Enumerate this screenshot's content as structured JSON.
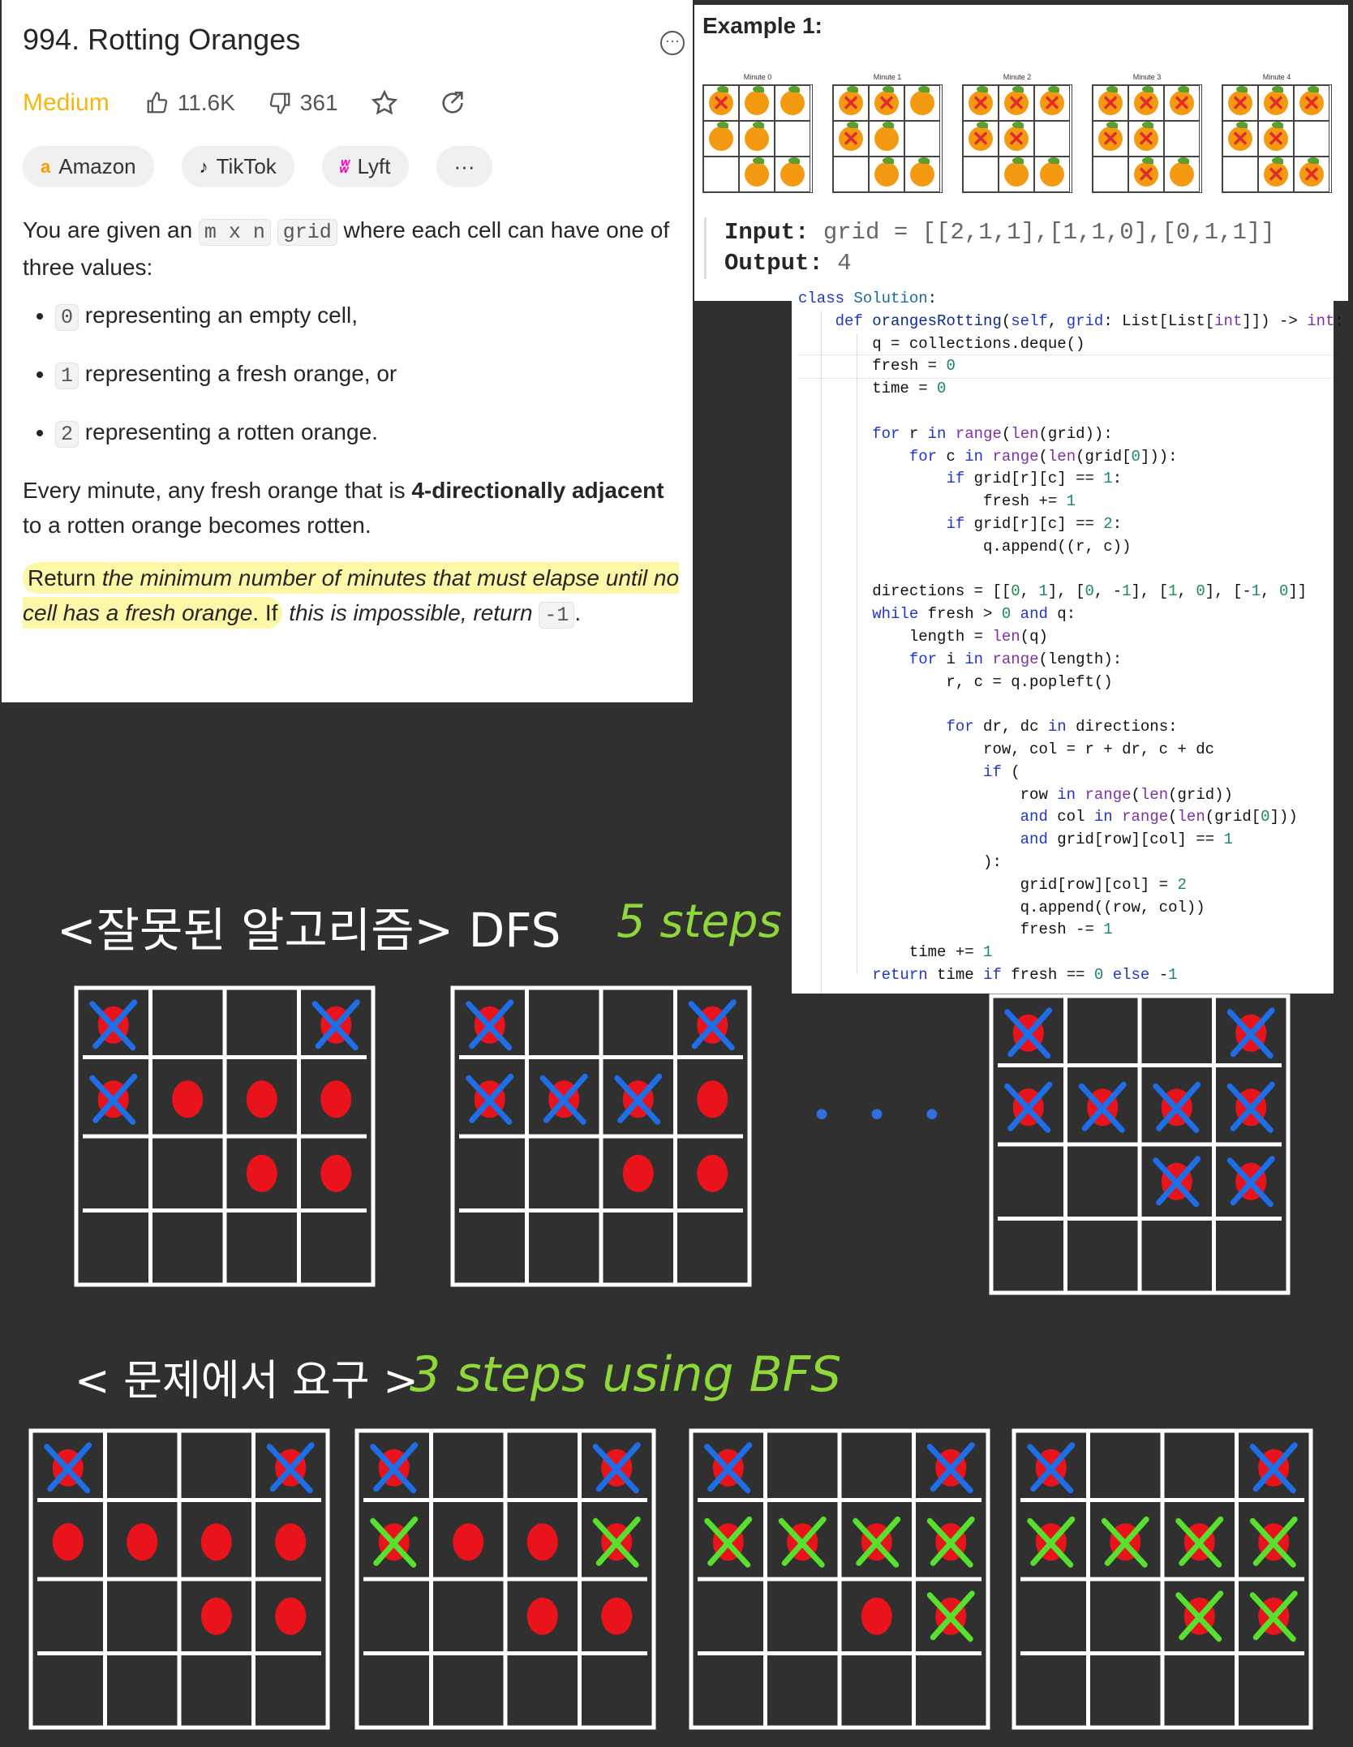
{
  "problem": {
    "title": "994. Rotting Oranges",
    "difficulty": "Medium",
    "likes": "11.6K",
    "dislikes": "361",
    "tags": [
      "Amazon",
      "TikTok",
      "Lyft"
    ],
    "more_tags": "···",
    "desc_1a": "You are given an",
    "code_mxn": "m x n",
    "code_grid": "grid",
    "desc_1b": "where each cell can have one of three values:",
    "bullets": [
      {
        "code": "0",
        "text": "representing an empty cell,"
      },
      {
        "code": "1",
        "text": "representing a fresh orange, or"
      },
      {
        "code": "2",
        "text": "representing a rotten orange."
      }
    ],
    "desc_2a": "Every minute, any fresh orange that is",
    "desc_2b": "4-directionally adjacent",
    "desc_2c": "to a rotten orange becomes rotten.",
    "desc_3a": "Return",
    "desc_3b": "the minimum number of minutes that must elapse until no cell has a fresh orange",
    "desc_3c": ". If",
    "desc_3d": "this is impossible, return",
    "desc_3e": "-1",
    "desc_3f": "."
  },
  "example": {
    "title": "Example 1:",
    "minutes": [
      "Minute 0",
      "Minute 1",
      "Minute 2",
      "Minute 3",
      "Minute 4"
    ],
    "input_label": "Input:",
    "input_value": "grid = [[2,1,1],[1,1,0],[0,1,1]]",
    "output_label": "Output:",
    "output_value": "4"
  },
  "code": {
    "language": "python"
  },
  "notes": {
    "dfs_title": "<잘못된 알고리즘> DFS",
    "dfs_steps": "5 steps",
    "dots": "• • •",
    "bfs_title": "< 문제에서 요구 >",
    "bfs_steps": "3 steps using BFS"
  }
}
